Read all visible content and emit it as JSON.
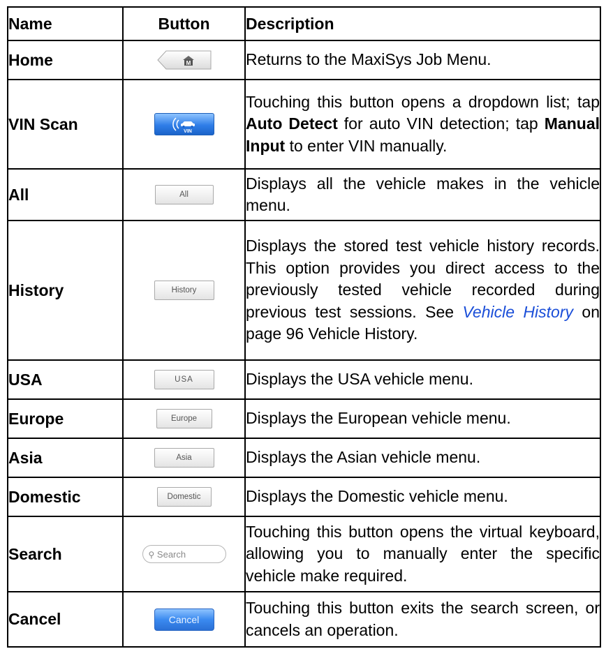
{
  "headers": {
    "name": "Name",
    "button": "Button",
    "description": "Description"
  },
  "rows": [
    {
      "name": "Home",
      "desc": [
        "Returns to the MaxiSys Job Menu."
      ]
    },
    {
      "name": "VIN Scan",
      "button_text": "VIN",
      "desc": [
        "Touching this button opens a dropdown list; tap ",
        "Auto Detect",
        " for auto VIN detection; tap ",
        "Manual Input",
        " to enter VIN manually."
      ]
    },
    {
      "name": "All",
      "button_text": "All",
      "desc": [
        "Displays all the vehicle makes in the vehicle menu."
      ]
    },
    {
      "name": "History",
      "button_text": "History",
      "desc": [
        "Displays the stored test vehicle history records. This option provides you direct access to the previously tested vehicle recorded during previous test sessions. See ",
        "Vehicle History",
        " on page 96 Vehicle History."
      ]
    },
    {
      "name": "USA",
      "button_text": "USA",
      "desc": [
        "Displays the USA vehicle menu."
      ]
    },
    {
      "name": "Europe",
      "button_text": "Europe",
      "desc": [
        "Displays the European vehicle menu."
      ]
    },
    {
      "name": "Asia",
      "button_text": "Asia",
      "desc": [
        "Displays the Asian vehicle menu."
      ]
    },
    {
      "name": "Domestic",
      "button_text": "Domestic",
      "desc": [
        "Displays the Domestic vehicle menu."
      ]
    },
    {
      "name": "Search",
      "button_text": "Search",
      "desc": [
        "Touching this button opens the virtual keyboard, allowing you to manually enter the specific vehicle make required."
      ]
    },
    {
      "name": "Cancel",
      "button_text": "Cancel",
      "desc": [
        "Touching this button exits the search screen, or cancels an operation."
      ]
    }
  ],
  "icons": {
    "home": "home-m-icon",
    "vin": "vin-car-scan-icon",
    "search": "magnifier-icon"
  },
  "colors": {
    "link": "#1a4ed8",
    "blue_button": "#2f7ee8"
  }
}
